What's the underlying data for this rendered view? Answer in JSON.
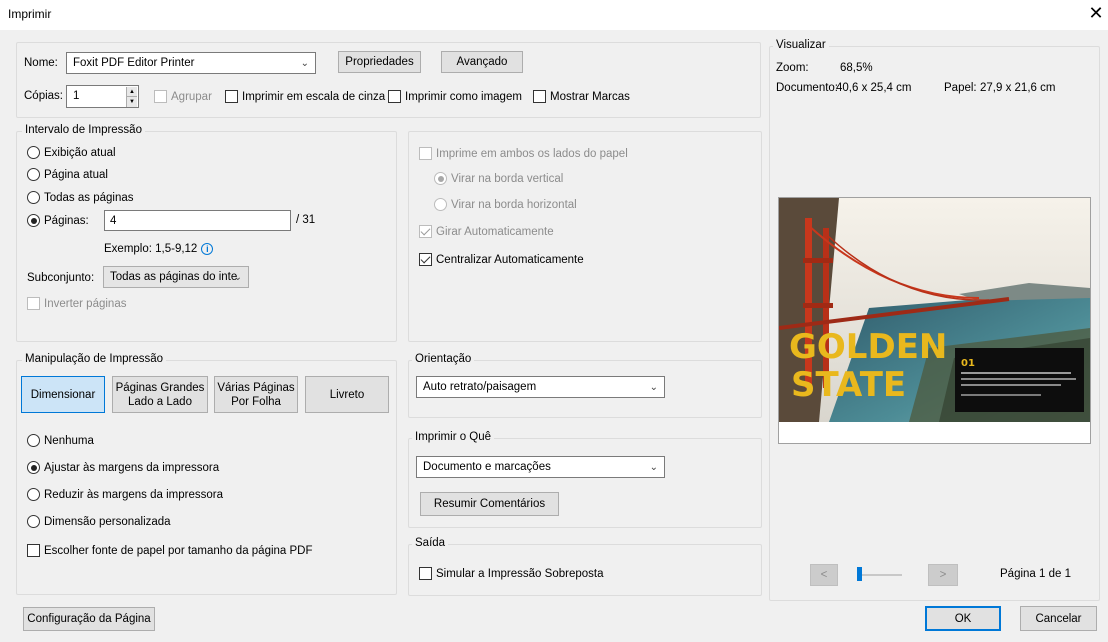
{
  "window": {
    "title": "Imprimir"
  },
  "printer": {
    "name_label": "Nome:",
    "name_value": "Foxit PDF Editor Printer",
    "properties_label": "Propriedades",
    "advanced_label": "Avançado",
    "copies_label": "Cópias:",
    "copies_value": "1",
    "collate_label": "Agrupar",
    "grayscale_label": "Imprimir em escala de cinza",
    "as_image_label": "Imprimir como imagem",
    "show_marks_label": "Mostrar Marcas"
  },
  "range": {
    "legend": "Intervalo de Impressão",
    "current_view": "Exibição atual",
    "current_page": "Página atual",
    "all_pages": "Todas as páginas",
    "pages_label": "Páginas:",
    "pages_value": "4",
    "pages_total": "/ 31",
    "example": "Exemplo: 1,5-9,12",
    "subset_label": "Subconjunto:",
    "subset_value": "Todas as páginas do inte",
    "reverse_label": "Inverter páginas"
  },
  "duplex": {
    "both_sides": "Imprime em ambos os lados do papel",
    "flip_long": "Virar na borda vertical",
    "flip_short": "Virar na borda horizontal",
    "auto_rotate": "Girar Automaticamente",
    "auto_center": "Centralizar Automaticamente"
  },
  "handling": {
    "legend": "Manipulação de Impressão",
    "tabs": [
      "Dimensionar",
      "Páginas Grandes\nLado a Lado",
      "Várias Páginas\nPor Folha",
      "Livreto"
    ],
    "none": "Nenhuma",
    "fit": "Ajustar às margens da impressora",
    "shrink": "Reduzir às margens da impressora",
    "custom": "Dimensão personalizada",
    "paper_source": "Escolher fonte de papel por tamanho da página PDF"
  },
  "orientation": {
    "legend": "Orientação",
    "value": "Auto retrato/paisagem"
  },
  "what": {
    "legend": "Imprimir o Quê",
    "value": "Documento e marcações",
    "summarize": "Resumir Comentários"
  },
  "output": {
    "legend": "Saída",
    "simulate": "Simular a Impressão Sobreposta"
  },
  "preview": {
    "legend": "Visualizar",
    "zoom_label": "Zoom:",
    "zoom_value": "68,5%",
    "doc_label": "Documento:",
    "doc_value": "40,6 x 25,4 cm",
    "paper_label": "Papel:",
    "paper_value": "27,9 x 21,6 cm",
    "headline_1": "GOLDEN",
    "headline_2": "STATE",
    "caption_number": "01",
    "page_indicator": "Página 1 de 1",
    "prev": "<",
    "next": ">"
  },
  "footer": {
    "page_setup": "Configuração da Página",
    "ok": "OK",
    "cancel": "Cancelar"
  },
  "colors": {
    "accent": "#0078d7",
    "selected_tab_bg": "#cce4f7",
    "headline": "#e9b81d"
  }
}
